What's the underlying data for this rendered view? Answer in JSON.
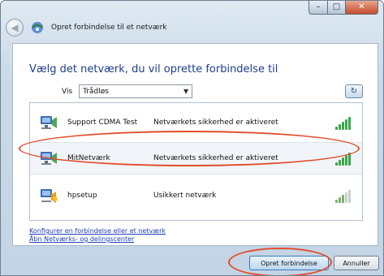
{
  "window": {
    "title": "Opret forbindelse til et netværk",
    "controls": {
      "minimize": "–",
      "maximize": "□",
      "close": "✕"
    }
  },
  "header": {
    "heading": "Vælg det netværk, du vil oprette forbindelse til"
  },
  "filter": {
    "label": "Vis",
    "selected": "Trådløs"
  },
  "networks": [
    {
      "name": "Support CDMA Test",
      "status": "Netværkets sikkerhed er aktiveret",
      "signal": 5,
      "icon": "secured-network-icon"
    },
    {
      "name": "MitNetværk",
      "status": "Netværkets sikkerhed er aktiveret",
      "signal": 5,
      "icon": "secured-network-icon",
      "selected": true
    },
    {
      "name": "hpsetup",
      "status": "Usikkert netværk",
      "signal": 3,
      "icon": "unsecured-network-icon"
    }
  ],
  "links": [
    {
      "label": "Konfigurer en forbindelse eller et netværk"
    },
    {
      "label": "Åbn Netværks- og delingscenter"
    }
  ],
  "buttons": {
    "connect": "Opret forbindelse",
    "cancel": "Annuller"
  },
  "colors": {
    "accent": "#1e3d8f",
    "link": "#1f3fb8",
    "annotation": "#e24c2a",
    "signal": "#3aa64a"
  }
}
